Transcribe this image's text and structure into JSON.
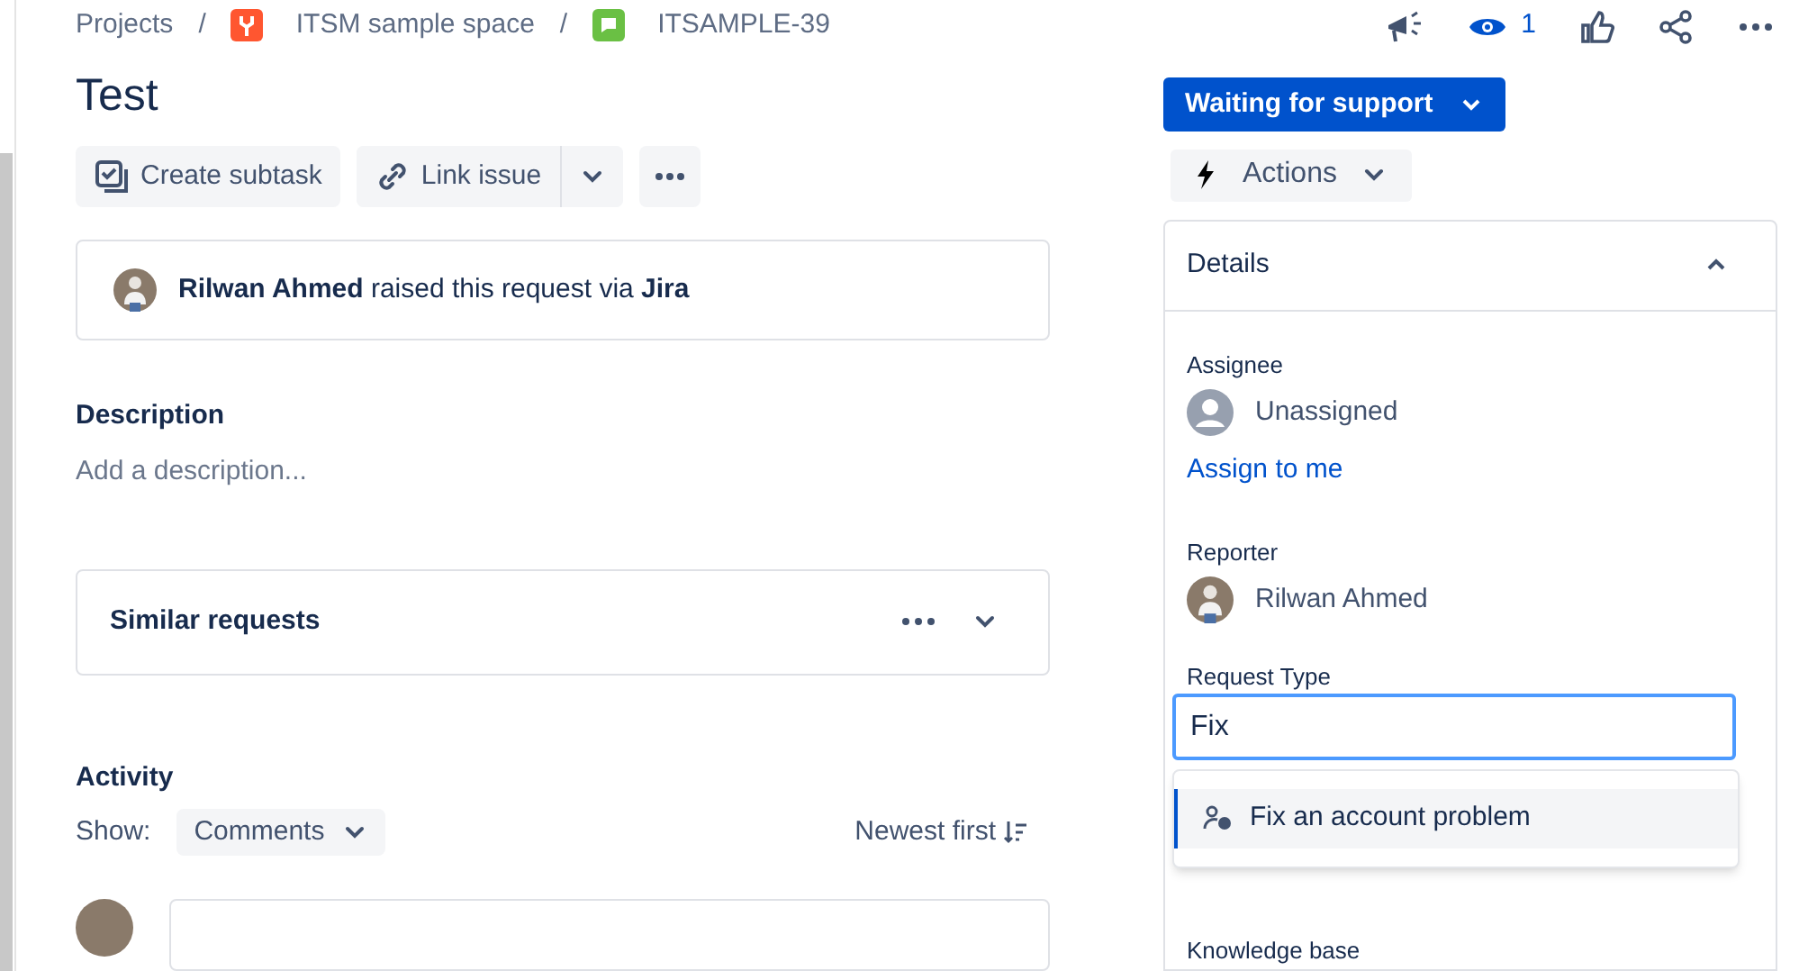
{
  "breadcrumbs": [
    {
      "kind": "root",
      "label": "Projects"
    },
    {
      "kind": "project",
      "separator": "/",
      "label": "ITSM sample space"
    },
    {
      "kind": "issue",
      "separator": "/",
      "label": "ITSAMPLE-39"
    }
  ],
  "header_actions": {
    "watchers": "1"
  },
  "title": "Test",
  "toolbar": [
    {
      "kind": "subtask",
      "label": "Create subtask"
    },
    {
      "kind": "link",
      "label": "Link issue"
    }
  ],
  "request_card": {
    "text": "**Rilwan Ahmed** raised this request via **Jira**"
  },
  "description": {
    "heading": "Description",
    "placeholder": "Add a description..."
  },
  "similar_requests": {
    "title": "Similar requests",
    "expanded": false
  },
  "activity": {
    "heading": "Activity",
    "show_label": "Show:",
    "filter": "Comments",
    "sort": "Newest first"
  },
  "status": {
    "label": "Waiting for support"
  },
  "actions": {
    "label": "Actions"
  },
  "details": {
    "title": "Details",
    "expanded": true,
    "assignee": {
      "label": "Assignee",
      "value": "Unassigned",
      "assign_link": "Assign to me"
    },
    "reporter": {
      "label": "Reporter",
      "value": "Rilwan Ahmed"
    },
    "request_type": {
      "label": "Request Type",
      "value": "Fix",
      "options": [
        {
          "label": "Fix an account problem",
          "selected": true
        }
      ]
    },
    "next_label": "Knowledge base"
  }
}
